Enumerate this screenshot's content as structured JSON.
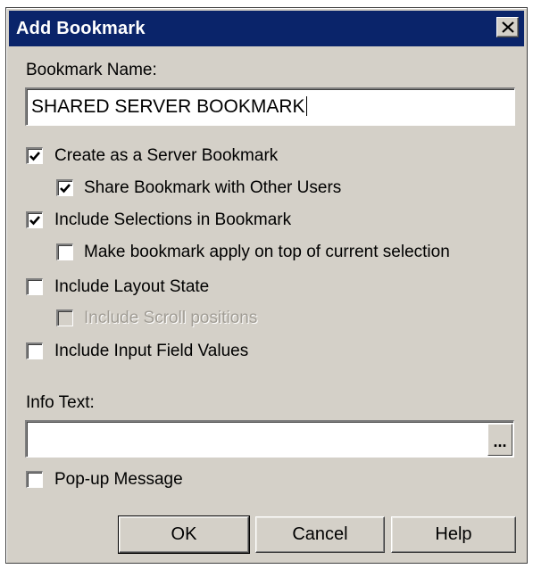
{
  "dialog": {
    "title": "Add Bookmark",
    "close_icon": "close-x-icon"
  },
  "bookmark_name": {
    "label": "Bookmark Name:",
    "value": "SHARED SERVER BOOKMARK"
  },
  "options": [
    {
      "label": "Create as a Server Bookmark",
      "checked": true,
      "enabled": true
    },
    {
      "label": "Share Bookmark with Other Users",
      "checked": true,
      "enabled": true
    },
    {
      "label": "Include Selections in Bookmark",
      "checked": true,
      "enabled": true
    },
    {
      "label": "Make bookmark apply on top of current selection",
      "checked": false,
      "enabled": true
    },
    {
      "label": "Include Layout State",
      "checked": false,
      "enabled": true
    },
    {
      "label": "Include Scroll positions",
      "checked": false,
      "enabled": false
    },
    {
      "label": "Include Input Field Values",
      "checked": false,
      "enabled": true
    }
  ],
  "info_text": {
    "label": "Info Text:",
    "value": "",
    "browse_label": "..."
  },
  "popup": {
    "label": "Pop-up Message",
    "checked": false
  },
  "buttons": {
    "ok": "OK",
    "cancel": "Cancel",
    "help": "Help"
  },
  "colors": {
    "titlebar": "#0a246a",
    "dialog_face": "#d4d0c8",
    "disabled_text": "#a09c94"
  }
}
